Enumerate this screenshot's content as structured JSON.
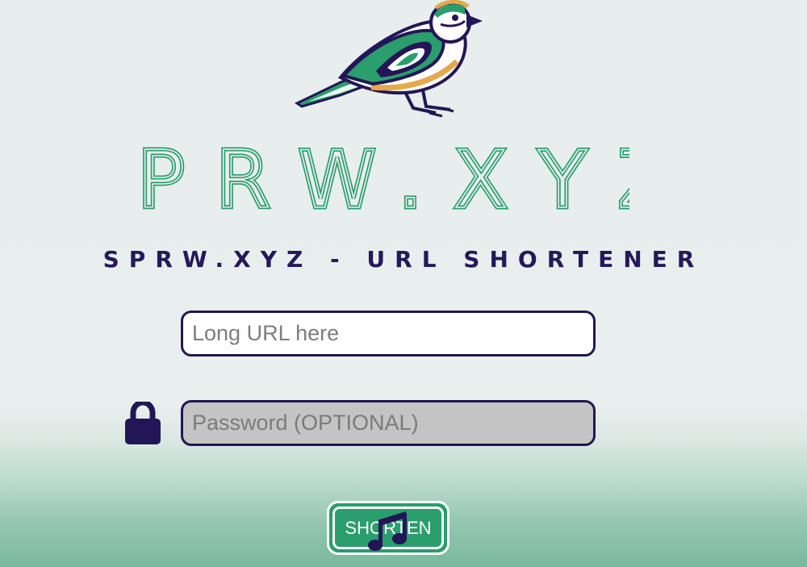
{
  "brand": {
    "logo_text": "SPRW.XYZ",
    "logo_icon": "sparrow-logo-icon",
    "subtitle": "SPRW.XYZ - URL SHORTENER"
  },
  "form": {
    "url_placeholder": "Long URL here",
    "url_value": "",
    "password_placeholder": "Password (OPTIONAL)",
    "password_value": "",
    "password_icon": "lock-icon",
    "submit_label": "SHORTEN",
    "overlay_icon": "music-note-icon"
  },
  "colors": {
    "brand_green": "#2a9e6c",
    "brand_navy": "#231656",
    "brand_gold": "#e4a94a"
  }
}
